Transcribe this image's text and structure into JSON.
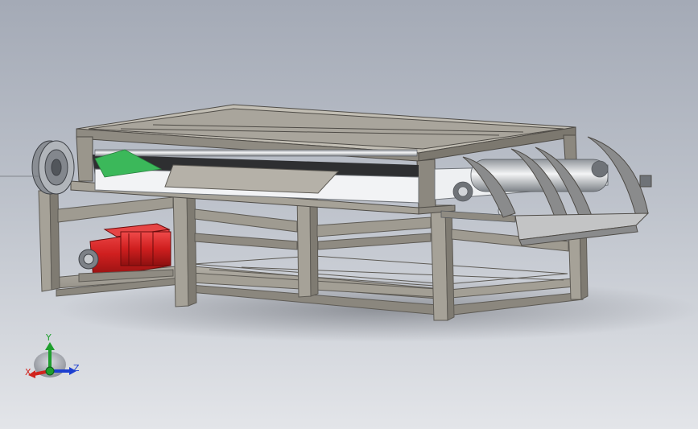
{
  "viewport": {
    "background_top": "#a4aab6",
    "background_bottom": "#e3e5e9"
  },
  "model": {
    "frame_color": "#9e9a91",
    "motor_color": "#d11f1f",
    "belt_color": "#f2f3f5",
    "accent_color": "#3bb85a"
  },
  "triad": {
    "x_label": "X",
    "y_label": "Y",
    "z_label": "Z",
    "x_color": "#d0241e",
    "y_color": "#1e9e2e",
    "z_color": "#1d3fd0"
  }
}
